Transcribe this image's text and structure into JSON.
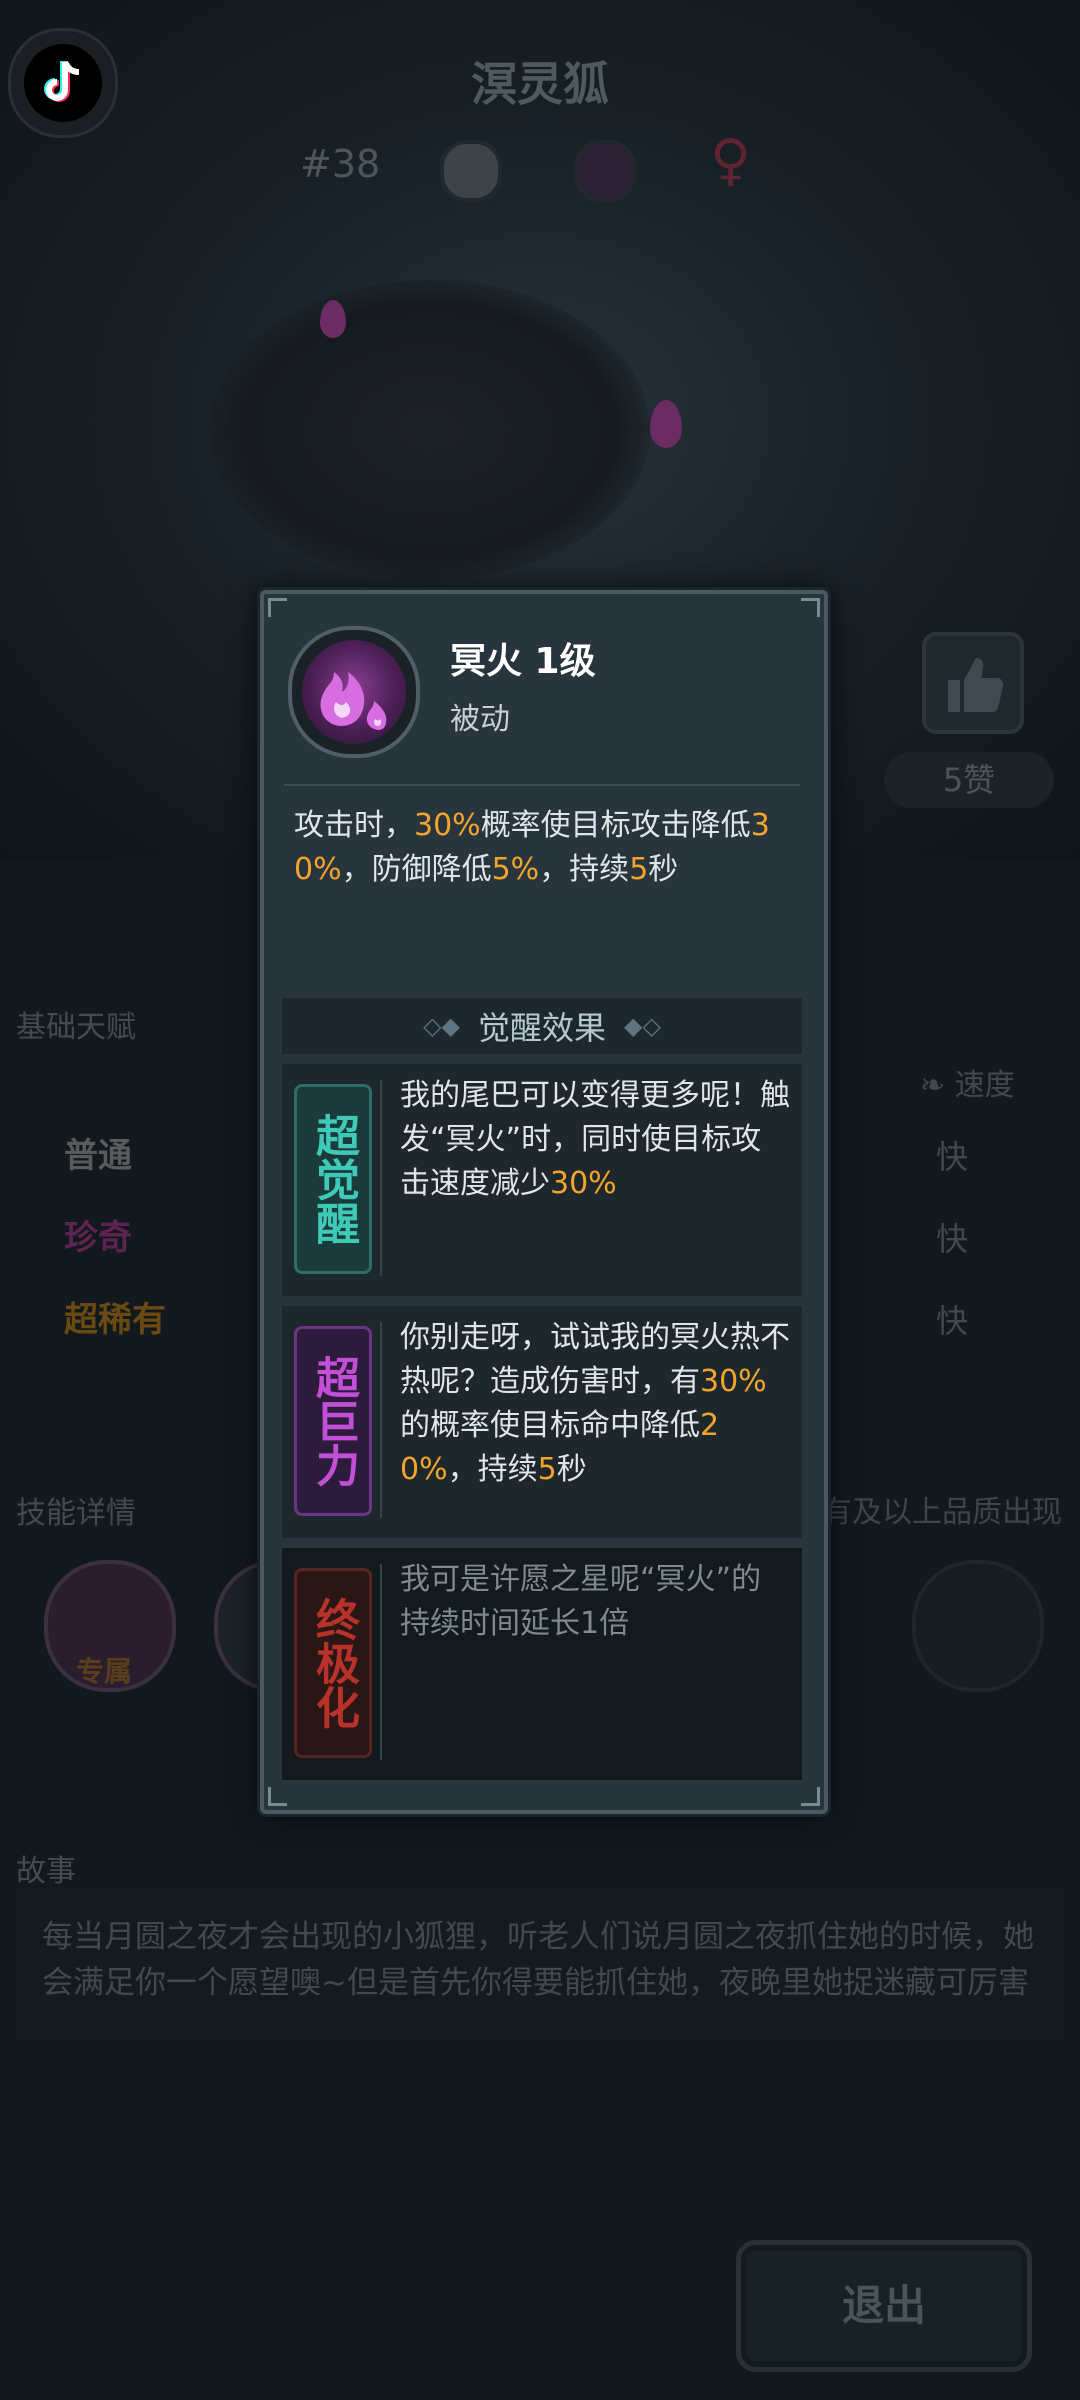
{
  "background": {
    "title": "溟灵狐",
    "number": "#38",
    "gender_symbol": "♀",
    "likes": "5赞",
    "basic_talent_label": "基础天赋",
    "tiers": [
      {
        "label": "普通",
        "color": "#6b6b6b"
      },
      {
        "label": "珍奇",
        "color": "#5e2350"
      },
      {
        "label": "超稀有",
        "color": "#6b4a12"
      }
    ],
    "speed_label": "速度",
    "speed_values": [
      "快",
      "快",
      "快"
    ],
    "skill_details_label": "技能详情",
    "quality_note": "有及以上品质出现",
    "exclusive_label": "专属",
    "story_label": "故事",
    "story_text": "每当月圆之夜才会出现的小狐狸，听老人们说月圆之夜抓住她的时候，她会满足你一个愿望噢~但是首先你得要能抓住她，夜晚里她捉迷藏可厉害",
    "exit_button": "退出"
  },
  "modal": {
    "skill_name": "冥火 1级",
    "skill_type": "被动",
    "description": {
      "p1": "攻击时，",
      "v1": "30%",
      "p2": "概率使目标攻击降低",
      "v2": "30%",
      "p3": "，防御降低",
      "v3": "5%",
      "p4": "，持续",
      "v4": "5",
      "p5": "秒"
    },
    "awakening_title": "觉醒效果",
    "awakenings": [
      {
        "badge": "超觉醒",
        "t1": "我的尾巴可以变得更多呢！触发“冥火”时，同时使目标攻击速度减少",
        "v1": "30%"
      },
      {
        "badge": "超巨力",
        "t1": "你别走呀，试试我的冥火热不热呢？造成伤害时，有",
        "v1": "30%",
        "t2": "的概率使目标命中降低",
        "v2": "20%",
        "t3": "，持续",
        "v3": "5",
        "t4": "秒"
      },
      {
        "badge": "终极化",
        "t1": "我可是许愿之星呢“冥火”的持续时间延长1倍"
      }
    ],
    "colors": {
      "highlight": "#f2a52a",
      "badge1": "#3fc9b8",
      "badge2": "#c34fd8",
      "badge3": "#b8322a"
    }
  }
}
